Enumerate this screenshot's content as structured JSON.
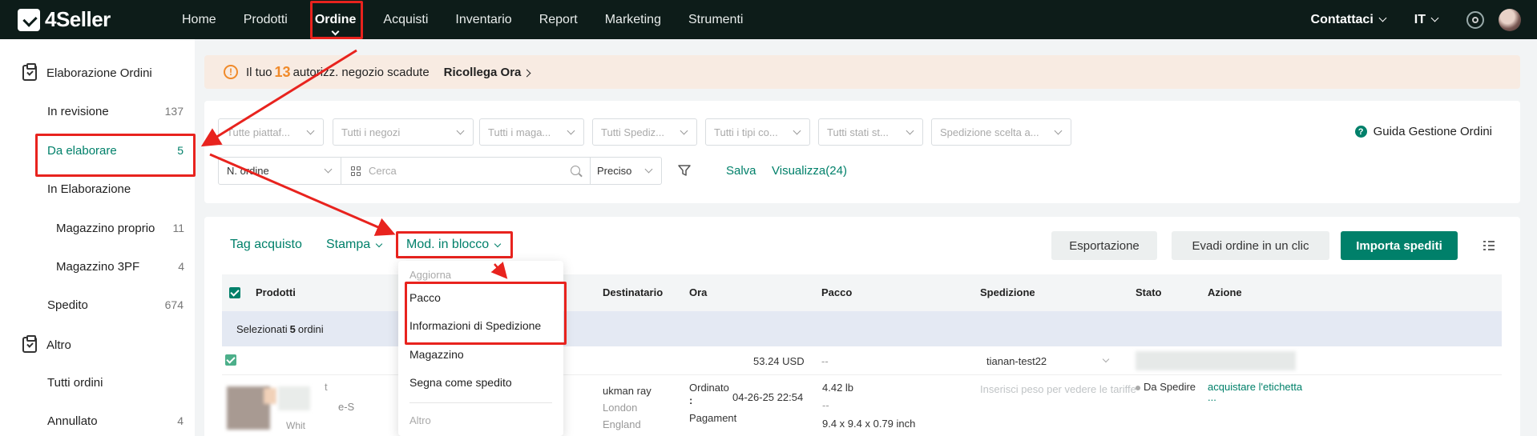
{
  "brand": "4Seller",
  "nav": {
    "items": [
      "Home",
      "Prodotti",
      "Ordine",
      "Acquisti",
      "Inventario",
      "Report",
      "Marketing",
      "Strumenti"
    ],
    "contact": "Contattaci",
    "lang": "IT"
  },
  "sidebar": {
    "group1": "Elaborazione Ordini",
    "in_revisione": {
      "label": "In revisione",
      "count": "137"
    },
    "da_elaborare": {
      "label": "Da elaborare",
      "count": "5"
    },
    "in_elaborazione": "In Elaborazione",
    "magazzino_proprio": {
      "label": "Magazzino proprio",
      "count": "11"
    },
    "magazzino_3pf": {
      "label": "Magazzino 3PF",
      "count": "4"
    },
    "spedito": {
      "label": "Spedito",
      "count": "674"
    },
    "group2": "Altro",
    "tutti_ordini": "Tutti ordini",
    "annullato": {
      "label": "Annullato",
      "count": "4"
    }
  },
  "banner": {
    "pre": "Il tuo",
    "num": "13",
    "post": "autorizz. negozio scadute",
    "link": "Ricollega Ora"
  },
  "filters": {
    "selects": [
      "Tutte piattaf...",
      "Tutti i negozi",
      "Tutti i maga...",
      "Tutti Spediz...",
      "Tutti i tipi co...",
      "Tutti stati st...",
      "Spedizione scelta a..."
    ],
    "guide": "Guida Gestione Ordini",
    "order_field": "N. ordine",
    "search_placeholder": "Cerca",
    "precision": "Preciso",
    "save": "Salva",
    "view": "Visualizza(24)"
  },
  "toolbar": {
    "tag": "Tag acquisto",
    "print": "Stampa",
    "bulk": "Mod. in blocco",
    "export": "Esportazione",
    "oneclick": "Evadi ordine in un clic",
    "import": "Importa spediti"
  },
  "table": {
    "headers": {
      "prodotti": "Prodotti",
      "destinatario": "Destinatario",
      "ora": "Ora",
      "pacco": "Pacco",
      "spedizione": "Spedizione",
      "stato": "Stato",
      "azione": "Azione"
    },
    "selected": {
      "pre": "Selezionati",
      "num": "5",
      "post": "ordini"
    },
    "row1": {
      "amount": "53.24 USD",
      "pacco": "--",
      "shipping": "tianan-test22"
    },
    "row2": {
      "name": "ukman ray",
      "city": "London",
      "country": "England",
      "ordered_label": "Ordinato",
      "ordered_colon": ":",
      "ordered_time": "04-26-25 22:54",
      "paid_label": "Pagament",
      "weight": "4.42 lb",
      "dash": "--",
      "dims": "9.4 x 9.4 x 0.79 inch",
      "weight_hint": "Inserisci peso per vedere le tariffe",
      "status": "Da Spedire",
      "action": "acquistare l'etichetta",
      "action_more": "...",
      "product_frag1": "t",
      "product_frag2": "e-S",
      "product_frag3": "Whit"
    }
  },
  "dropdown": {
    "section1": "Aggiorna",
    "items": [
      "Pacco",
      "Informazioni di Spedizione",
      "Magazzino",
      "Segna come spedito"
    ],
    "section2": "Altro"
  },
  "colors": {
    "accent": "#00806a",
    "nav_bg": "#0d1c19",
    "highlight": "#e8231e",
    "warning": "#f08a2a"
  }
}
